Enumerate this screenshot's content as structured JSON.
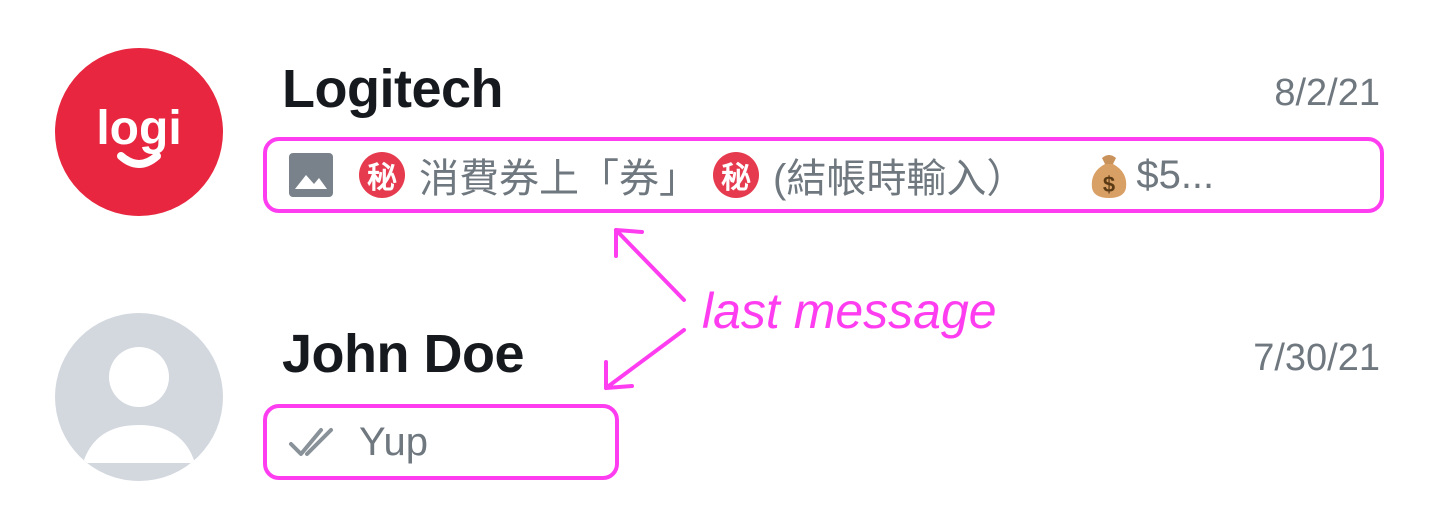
{
  "chats": [
    {
      "name": "Logitech",
      "date": "8/2/21",
      "avatar_text": "logi",
      "avatar_color": "#e8263f",
      "preview": {
        "icon": "image-icon",
        "emoji_1": "秘",
        "text_1": "消費券上「券」",
        "emoji_2": "秘",
        "text_2": "(結帳時輸入）",
        "emoji_3": "money-bag-emoji",
        "text_3": "$5..."
      }
    },
    {
      "name": "John Doe",
      "date": "7/30/21",
      "avatar": "default-person-avatar",
      "preview": {
        "icon": "double-check-icon",
        "text": "Yup"
      }
    }
  ],
  "annotation": {
    "label": "last message",
    "color": "#ff3df0"
  }
}
